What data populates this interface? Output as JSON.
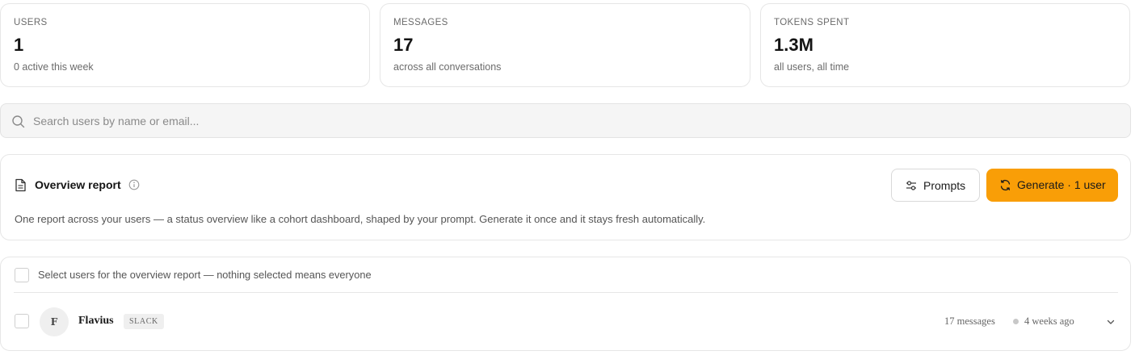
{
  "stats": [
    {
      "label": "USERS",
      "value": "1",
      "sub": "0 active this week"
    },
    {
      "label": "MESSAGES",
      "value": "17",
      "sub": "across all conversations"
    },
    {
      "label": "TOKENS SPENT",
      "value": "1.3M",
      "sub": "all users, all time"
    }
  ],
  "search": {
    "placeholder": "Search users by name or email...",
    "icon": "search-icon"
  },
  "report": {
    "title": "Overview report",
    "description": "One report across your users — a status overview like a cohort dashboard, shaped by your prompt. Generate it once and it stays fresh automatically.",
    "prompts_label": "Prompts",
    "generate_label": "Generate · 1 user",
    "accent_color": "#f99e07"
  },
  "users": {
    "select_all_label": "Select users for the overview report — nothing selected means everyone",
    "rows": [
      {
        "initial": "F",
        "name": "Flavius",
        "source": "SLACK",
        "messages": "17 messages",
        "last_active": "4 weeks ago"
      }
    ]
  }
}
